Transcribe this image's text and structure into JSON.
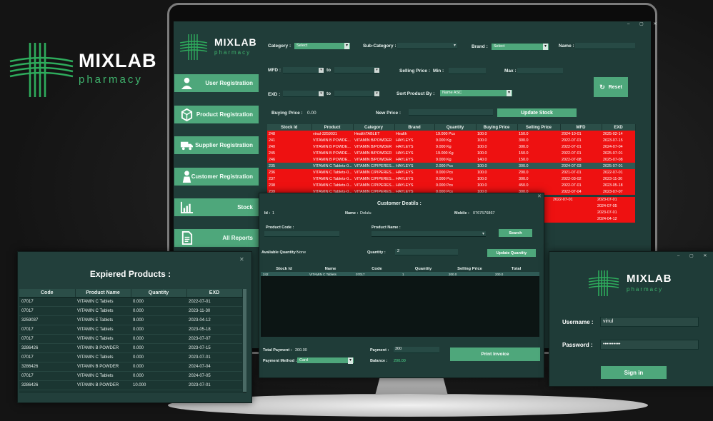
{
  "brand": {
    "name": "MIXLAB",
    "sub": "pharmacy"
  },
  "sidebar": {
    "items": [
      {
        "label": "User Registration",
        "icon": "user-icon"
      },
      {
        "label": "Product Registration",
        "icon": "box-icon"
      },
      {
        "label": "Supplier Registration",
        "icon": "truck-icon"
      },
      {
        "label": "Customer Registration",
        "icon": "customer-icon"
      },
      {
        "label": "Stock",
        "icon": "chart-icon"
      },
      {
        "label": "All Reports",
        "icon": "report-icon"
      }
    ]
  },
  "stock": {
    "category_label": "Category :",
    "category_value": "Select",
    "subcategory_label": "Sub-Category :",
    "brand_label": "Brand :",
    "brand_value": "Select",
    "name_label": "Name :",
    "mfd_label": "MFD :",
    "to1": "to",
    "selling_price_label": "Selling Price :",
    "min_label": "Min :",
    "max_label": "Max :",
    "exd_label": "EXD :",
    "to2": "to",
    "sort_label": "Sort Product By :",
    "sort_value": "Name ASC",
    "reset_label": "Reset",
    "buying_price_label": "Buying Price :",
    "buying_price_value": "0.00",
    "new_price_label": "New Price :",
    "update_stock_label": "Update Stock",
    "columns": [
      "Stock Id",
      "Product",
      "Category",
      "Brand",
      "Quantity",
      "Buying Price",
      "Selling Price",
      "MFD",
      "EXD"
    ],
    "rows": [
      {
        "id": "248",
        "product": "vinul-3259031",
        "category": "HealthTABLET",
        "brand": "Health",
        "qty": "19.000 Pcs",
        "buy": "100.0",
        "sell": "150.0",
        "mfd": "2024-10-01",
        "exd": "2025-02-14",
        "style": "red"
      },
      {
        "id": "241",
        "product": "VITAMIN B POWDE...",
        "category": "VITAMIN B/POWDER",
        "brand": "HAYLEYS",
        "qty": "9.000 Kg",
        "buy": "100.0",
        "sell": "300.0",
        "mfd": "2022-07-01",
        "exd": "2023-07-15",
        "style": "red"
      },
      {
        "id": "240",
        "product": "VITAMIN B POWDE...",
        "category": "VITAMIN B/POWDER",
        "brand": "HAYLEYS",
        "qty": "9.000 Kg",
        "buy": "100.0",
        "sell": "300.0",
        "mfd": "2022-07-01",
        "exd": "2024-07-04",
        "style": "red"
      },
      {
        "id": "245",
        "product": "VITAMIN B POWDE...",
        "category": "VITAMIN B/POWDER",
        "brand": "HAYLEYS",
        "qty": "19.000 Kg",
        "buy": "100.0",
        "sell": "150.0",
        "mfd": "2022-07-01",
        "exd": "2025-07-01",
        "style": "red"
      },
      {
        "id": "246",
        "product": "VITAMIN B POWDE...",
        "category": "VITAMIN B/POWDER",
        "brand": "HAYLEYS",
        "qty": "9.000 Kg",
        "buy": "140.0",
        "sell": "150.0",
        "mfd": "2022-07-08",
        "exd": "2025-07-08",
        "style": "red"
      },
      {
        "id": "235",
        "product": "VITAMIN C Tablets-0...",
        "category": "VITAMIN C/PIPERES...",
        "brand": "HAYLEYS",
        "qty": "2.000 Pcs",
        "buy": "100.0",
        "sell": "300.0",
        "mfd": "2024-07-03",
        "exd": "2025-07-01",
        "style": "sel"
      },
      {
        "id": "236",
        "product": "VITAMIN C Tablets-0...",
        "category": "VITAMIN C/PIPERES...",
        "brand": "HAYLEYS",
        "qty": "0.000 Pcs",
        "buy": "100.0",
        "sell": "200.0",
        "mfd": "2021-07-01",
        "exd": "2022-07-01",
        "style": "red"
      },
      {
        "id": "237",
        "product": "VITAMIN C Tablets-0...",
        "category": "VITAMIN C/PIPERES...",
        "brand": "HAYLEYS",
        "qty": "0.000 Pcs",
        "buy": "100.0",
        "sell": "300.0",
        "mfd": "2022-03-02",
        "exd": "2023-11-30",
        "style": "red"
      },
      {
        "id": "238",
        "product": "VITAMIN C Tablets-0...",
        "category": "VITAMIN C/PIPERES...",
        "brand": "HAYLEYS",
        "qty": "0.000 Pcs",
        "buy": "100.0",
        "sell": "450.0",
        "mfd": "2022-07-01",
        "exd": "2023-05-18",
        "style": "red"
      },
      {
        "id": "239",
        "product": "VITAMIN C Tablets-0...",
        "category": "VITAMIN C/PIPERES...",
        "brand": "HAYLEYS",
        "qty": "0.000 Pcs",
        "buy": "100.0",
        "sell": "300.0",
        "mfd": "2022-07-04",
        "exd": "2023-07-07",
        "style": "red"
      }
    ],
    "hidden_exd": [
      "2023-07-01",
      "2024-07-05",
      "2023-07-01",
      "2024-04-12"
    ]
  },
  "customer": {
    "title": "Customer Deatils :",
    "id_label": "Id :",
    "id_value": "1",
    "name_label": "Name :",
    "name_value": "Dolulu",
    "mobile_label": "Mobile :",
    "mobile_value": "0767576867",
    "product_code_label": "Product Code :",
    "product_name_label": "Product Name :",
    "search_label": "Search",
    "avail_label": "Avaliable Quantity :",
    "avail_value": "None",
    "qty_label": "Quantity :",
    "qty_value": "2",
    "update_qty_label": "Update Quantity",
    "columns": [
      "Stock Id",
      "Name",
      "Code",
      "Quantity",
      "Selling Price",
      "Total"
    ],
    "row": [
      "242",
      "VITAMIN C Tablets",
      "07017",
      "1",
      "200.0",
      "200.0"
    ],
    "total_payment_label": "Total Payment :",
    "total_payment_value": "200.00",
    "payment_label": "Payment :",
    "payment_value": "300",
    "payment_method_label": "Payment Method :",
    "payment_method_value": "Card",
    "balance_label": "Balance :",
    "balance_value": "200.00",
    "print_label": "Print Invoice"
  },
  "expired": {
    "title": "Expiered Products :",
    "columns": [
      "Code",
      "Product Name",
      "Quantity",
      "EXD"
    ],
    "rows": [
      [
        "07017",
        "VITAMIN C Tablets",
        "0.000",
        "2022-07-01"
      ],
      [
        "07017",
        "VITAMIN C Tablets",
        "0.000",
        "2023-11-30"
      ],
      [
        "3259037",
        "VITAMIN E Tablets",
        "9.000",
        "2023-04-12"
      ],
      [
        "07017",
        "VITAMIN C Tablets",
        "0.000",
        "2023-05-18"
      ],
      [
        "07017",
        "VITAMIN C Tablets",
        "0.000",
        "2023-07-07"
      ],
      [
        "3286426",
        "VITAMIN B POWDER",
        "0.000",
        "2023-07-15"
      ],
      [
        "07017",
        "VITAMIN C Tablets",
        "0.000",
        "2023-07-01"
      ],
      [
        "3286426",
        "VITAMIN B POWDER",
        "0.000",
        "2024-07-04"
      ],
      [
        "07017",
        "VITAMIN C Tablets",
        "0.000",
        "2024-07-05"
      ],
      [
        "3286426",
        "VITAMIN B POWDER",
        "10.000",
        "2023-07-01"
      ]
    ]
  },
  "login": {
    "brand": "MIXLAB",
    "sub": "pharmacy",
    "username_label": "Username :",
    "username_value": "vinul",
    "password_label": "Password :",
    "password_value": "••••••••••",
    "signin_label": "Sign in"
  },
  "colors": {
    "accent": "#4ea77b",
    "panel": "#1f3c38",
    "alert": "#ee1111"
  }
}
